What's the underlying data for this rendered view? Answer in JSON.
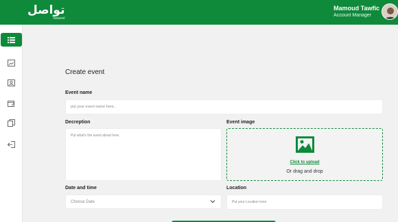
{
  "header": {
    "logo_text": "تواصل",
    "logo_sub": "tawasol",
    "user_name": "Mamoud Tawfic",
    "user_role": "Account Manager"
  },
  "sidebar": {
    "items": [
      {
        "icon": "list-icon",
        "active": true
      },
      {
        "icon": "image-card-icon",
        "active": false
      },
      {
        "icon": "id-card-icon",
        "active": false
      },
      {
        "icon": "calendar-edit-icon",
        "active": false
      },
      {
        "icon": "documents-icon",
        "active": false
      },
      {
        "icon": "logout-icon",
        "active": false
      }
    ]
  },
  "form": {
    "title": "Create event",
    "event_name_label": "Event name",
    "event_name_placeholder": "put your event name here..",
    "description_label": "Decreption",
    "description_placeholder": "Put what's the event about here..",
    "event_image_label": "Event image",
    "upload_link": "Click to upload",
    "upload_sub": "Or drag and drop",
    "date_label": "Date and time",
    "date_placeholder": "Choose Date",
    "location_label": "Location",
    "location_placeholder": "Put your Location here"
  },
  "colors": {
    "brand": "#0e8a3a",
    "background": "#f1f1f1"
  }
}
